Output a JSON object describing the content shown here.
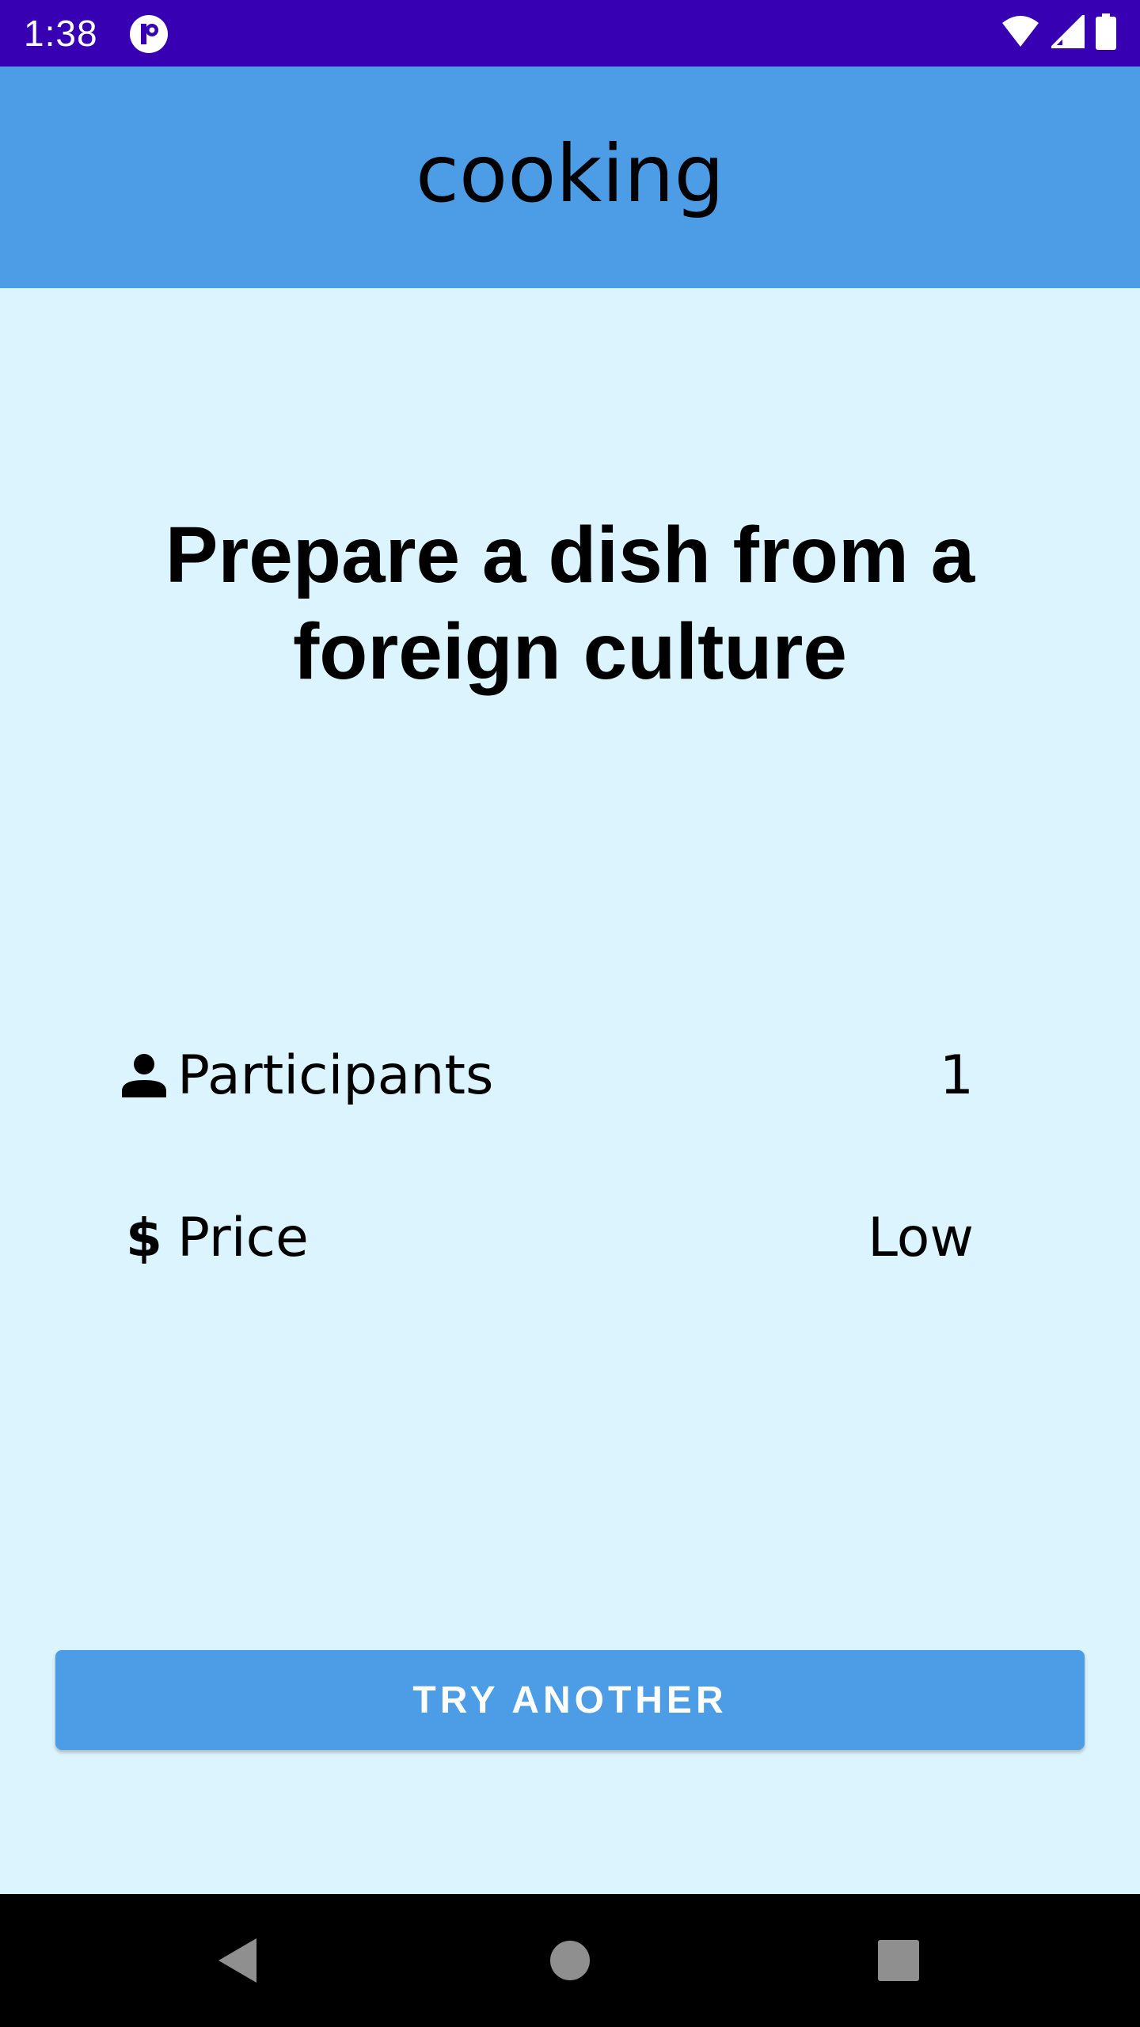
{
  "status_bar": {
    "time": "1:38",
    "background_color": "#3700B3",
    "icons": [
      "app-notification-icon",
      "wifi-icon",
      "cellular-signal-icon",
      "battery-icon"
    ]
  },
  "app_bar": {
    "title": "cooking",
    "background_color": "#4D9CE6"
  },
  "activity": {
    "title": "Prepare a dish from a foreign culture"
  },
  "details": {
    "participants": {
      "icon": "person-icon",
      "label": "Participants",
      "value": "1"
    },
    "price": {
      "icon": "dollar-icon",
      "label": "Price",
      "value": "Low"
    }
  },
  "actions": {
    "try_another_label": "TRY ANOTHER"
  },
  "navigation_bar": {
    "icons": [
      "back-icon",
      "home-icon",
      "recents-icon"
    ]
  },
  "colors": {
    "page_background": "#DBF4FE",
    "accent": "#4D9CE6"
  }
}
